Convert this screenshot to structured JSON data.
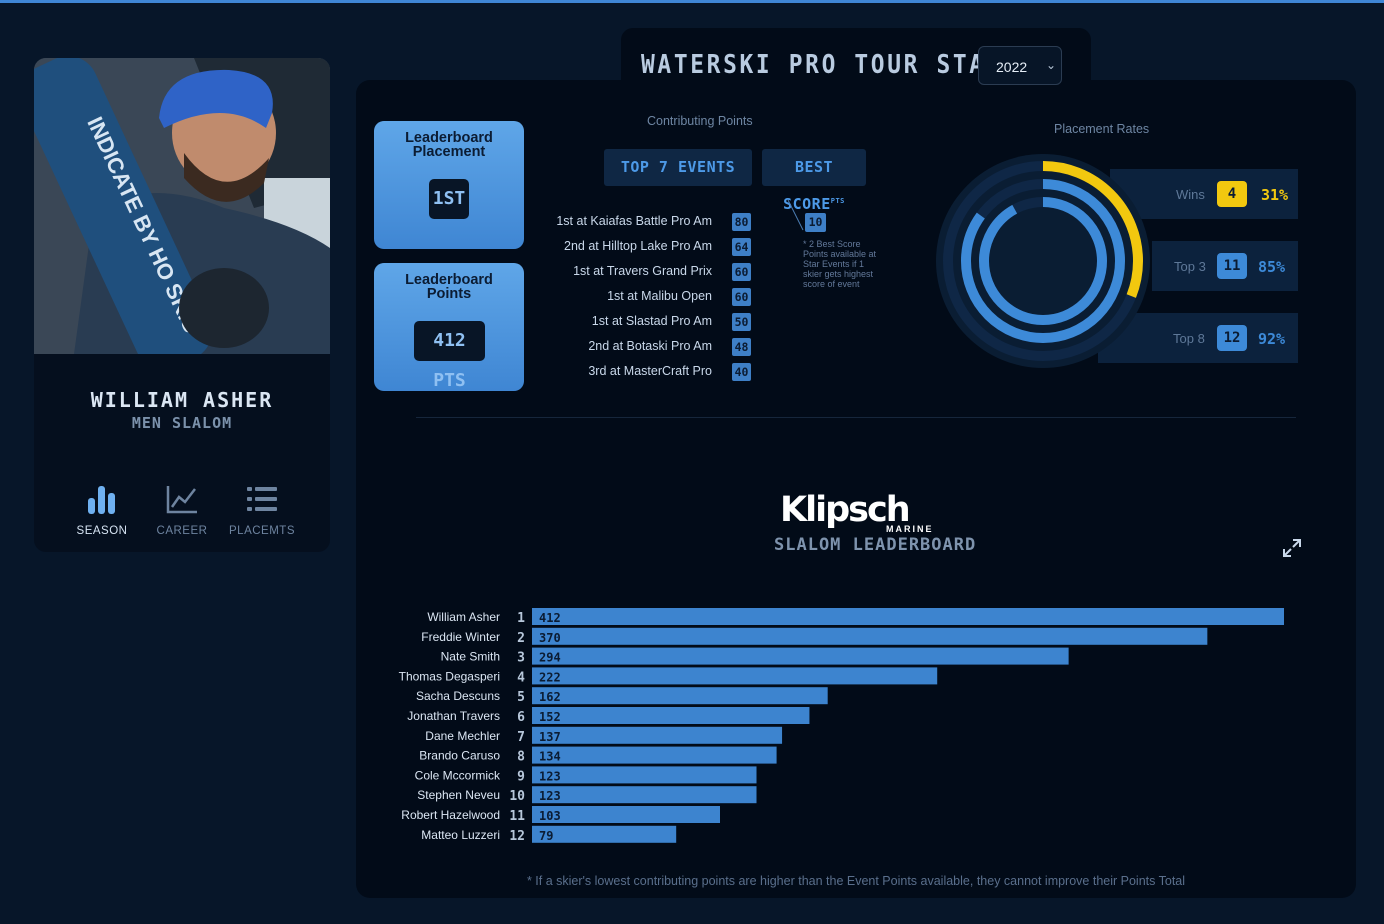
{
  "player": {
    "name": "WILLIAM ASHER",
    "division": "MEN SLALOM",
    "ski_brand_text": "INDICATE BY HO SKIS"
  },
  "nav": [
    {
      "label": "SEASON",
      "icon": "bar-chart-icon",
      "active": true
    },
    {
      "label": "CAREER",
      "icon": "line-chart-icon",
      "active": false
    },
    {
      "label": "PLACEMTS",
      "icon": "list-icon",
      "active": false
    }
  ],
  "header": {
    "title": "WATERSKI PRO TOUR STATS",
    "year": "2022"
  },
  "leaderboard": {
    "placement_title_1": "Leaderboard",
    "placement_title_2": "Placement",
    "placement_value": "1ST",
    "points_title_1": "Leaderboard",
    "points_title_2": "Points",
    "points_value": "412 PTS"
  },
  "contributing": {
    "label": "Contributing Points",
    "tab_top7": "TOP 7 EVENTS",
    "tab_best": "BEST SCORE",
    "tab_best_sup": "PTS",
    "events": [
      {
        "name": "1st at Kaiafas Battle Pro Am",
        "pts": "80"
      },
      {
        "name": "2nd at Hilltop Lake Pro Am",
        "pts": "64"
      },
      {
        "name": "1st at Travers Grand Prix",
        "pts": "60"
      },
      {
        "name": "1st at Malibu Open",
        "pts": "60"
      },
      {
        "name": "1st at Slastad Pro Am",
        "pts": "50"
      },
      {
        "name": "2nd at Botaski Pro Am",
        "pts": "48"
      },
      {
        "name": "3rd at MasterCraft Pro",
        "pts": "40"
      }
    ],
    "best_score": "10",
    "best_note": "* 2 Best Score Points available at Star Events if 1 skier gets highest score of event"
  },
  "placement_rates": {
    "label": "Placement Rates",
    "rows": [
      {
        "label": "Wins",
        "count": "4",
        "pct": "31%",
        "fraction": 0.31,
        "color": "#f2c80f"
      },
      {
        "label": "Top 3",
        "count": "11",
        "pct": "85%",
        "fraction": 0.85,
        "color": "#3d8ad8"
      },
      {
        "label": "Top 8",
        "count": "12",
        "pct": "92%",
        "fraction": 0.92,
        "color": "#3d8ad8"
      }
    ]
  },
  "brand": {
    "name": "Klipsch",
    "sub": "MARINE"
  },
  "chart_data": {
    "type": "bar",
    "title": "SLALOM LEADERBOARD",
    "orientation": "horizontal",
    "categories": [
      "William Asher",
      "Freddie Winter",
      "Nate Smith",
      "Thomas Degasperi",
      "Sacha Descuns",
      "Jonathan Travers",
      "Dane Mechler",
      "Brando Caruso",
      "Cole Mccormick",
      "Stephen Neveu",
      "Robert Hazelwood",
      "Matteo Luzzeri"
    ],
    "ranks": [
      "1",
      "2",
      "3",
      "4",
      "5",
      "6",
      "7",
      "8",
      "9",
      "10",
      "11",
      "12"
    ],
    "values": [
      412,
      370,
      294,
      222,
      162,
      152,
      137,
      134,
      123,
      123,
      103,
      79
    ],
    "bar_color": "#3d84cf"
  },
  "footnote": "* If a skier's lowest contributing points are higher than the Event Points available, they cannot improve their Points Total"
}
